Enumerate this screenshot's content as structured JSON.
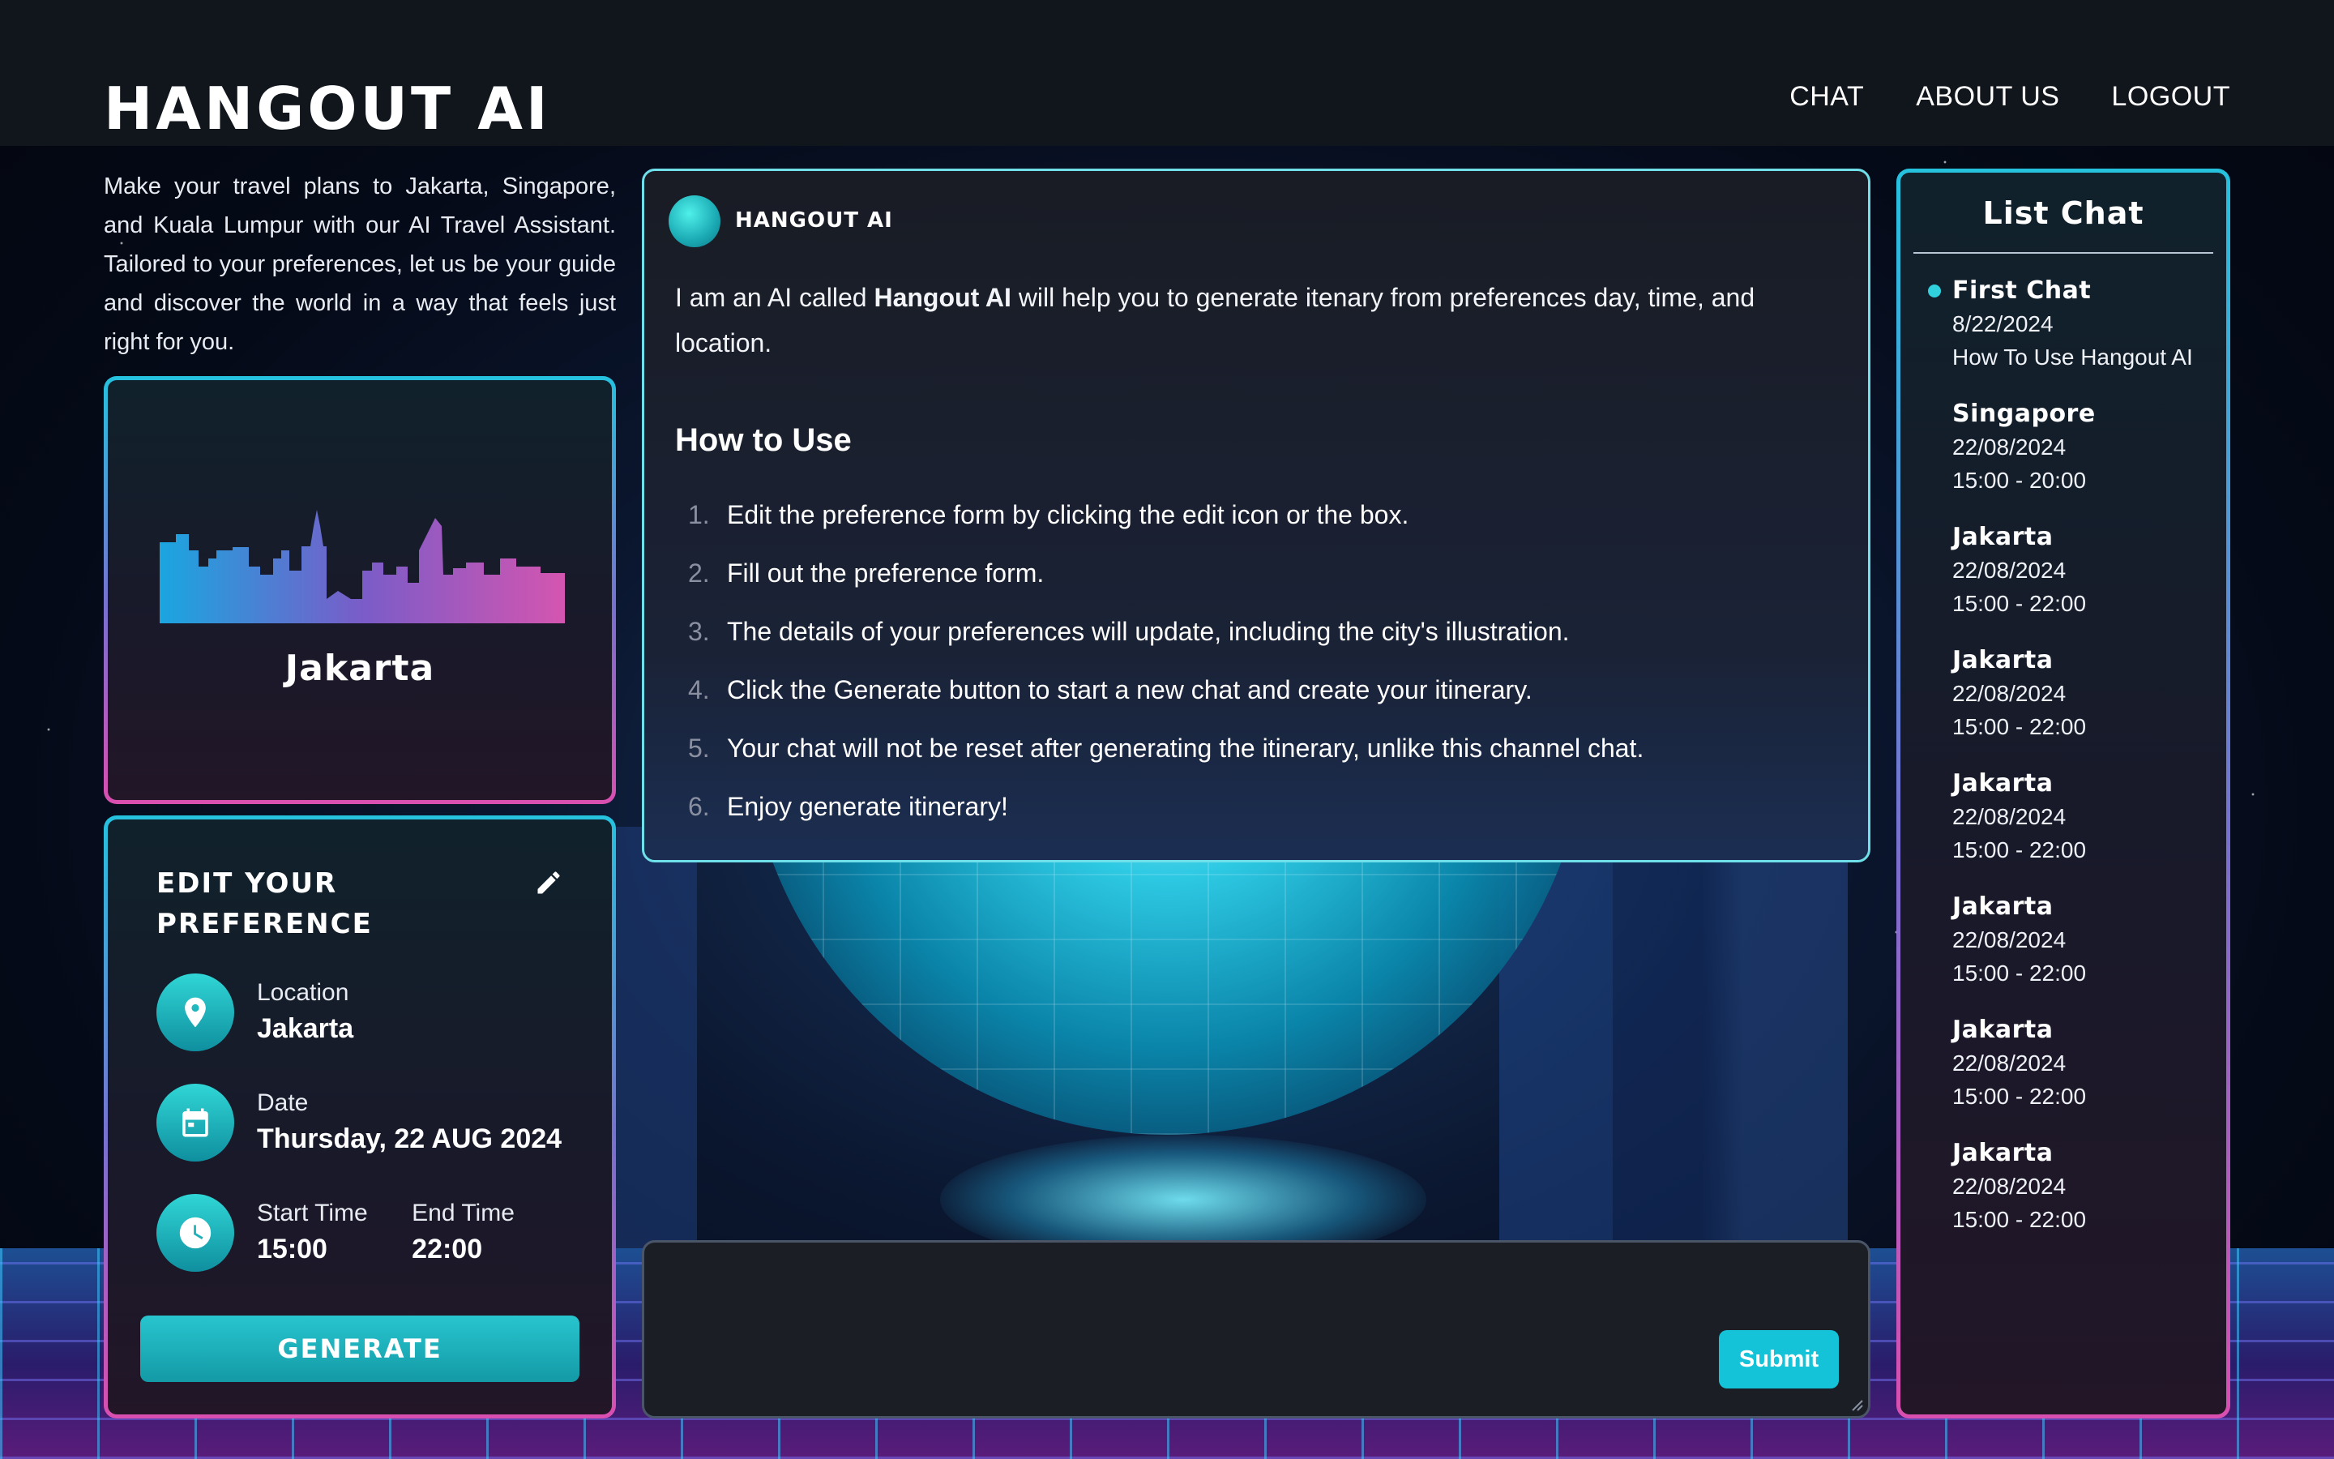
{
  "app": {
    "brand": "HANGOUT AI",
    "nav": [
      "CHAT",
      "ABOUT US",
      "LOGOUT"
    ]
  },
  "intro": "Make your travel plans to Jakarta, Singapore, and Kuala Lumpur with our AI Travel Assistant. Tailored to your preferences, let us be your guide and discover the world in a way that feels just right for you.",
  "city_card": {
    "city": "Jakarta",
    "illustration": "jakarta-skyline-illustration"
  },
  "preference": {
    "title": "EDIT YOUR PREFERENCE",
    "location_label": "Location",
    "location_value": "Jakarta",
    "date_label": "Date",
    "date_value": "Thursday, 22 AUG 2024",
    "start_label": "Start Time",
    "start_value": "15:00",
    "end_label": "End Time",
    "end_value": "22:00",
    "generate_label": "GENERATE",
    "icons": [
      "pencil-icon",
      "location-pin-icon",
      "calendar-icon",
      "clock-icon"
    ]
  },
  "chat": {
    "bot_name": "HANGOUT AI",
    "intro_pre": "I am an AI called ",
    "intro_bold": "Hangout AI",
    "intro_post": " will help you to generate itenary from preferences day, time, and location.",
    "howto_title": "How to Use",
    "steps": [
      "Edit the preference form by clicking the edit icon or the box.",
      "Fill out the preference form.",
      "The details of your preferences will update, including the city's illustration.",
      "Click the Generate button to start a new chat and create your itinerary.",
      "Your chat will not be reset after generating the itinerary, unlike this channel chat.",
      "Enjoy generate itinerary!"
    ]
  },
  "input": {
    "placeholder": "",
    "submit_label": "Submit"
  },
  "list_chat": {
    "title": "List Chat",
    "items": [
      {
        "title": "First Chat",
        "line1": "8/22/2024",
        "line2": "How To Use Hangout AI",
        "active": true
      },
      {
        "title": "Singapore",
        "line1": "22/08/2024",
        "line2": "15:00 - 20:00"
      },
      {
        "title": "Jakarta",
        "line1": "22/08/2024",
        "line2": "15:00 - 22:00"
      },
      {
        "title": "Jakarta",
        "line1": "22/08/2024",
        "line2": "15:00 - 22:00"
      },
      {
        "title": "Jakarta",
        "line1": "22/08/2024",
        "line2": "15:00 - 22:00"
      },
      {
        "title": "Jakarta",
        "line1": "22/08/2024",
        "line2": "15:00 - 22:00"
      },
      {
        "title": "Jakarta",
        "line1": "22/08/2024",
        "line2": "15:00 - 22:00"
      },
      {
        "title": "Jakarta",
        "line1": "22/08/2024",
        "line2": "15:00 - 22:00"
      }
    ]
  },
  "colors": {
    "accent": "#14c3d8",
    "header_bg": "#11151c",
    "border_cyan": "#25c2de",
    "border_pink": "#d94fb0"
  }
}
